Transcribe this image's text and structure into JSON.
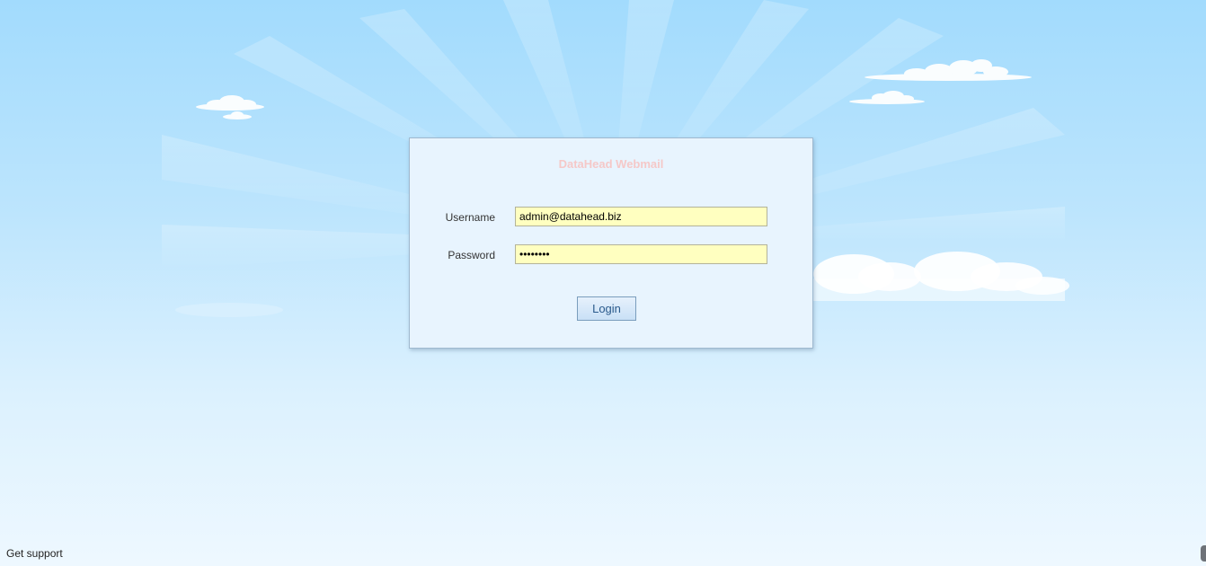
{
  "login": {
    "title": "DataHead Webmail",
    "username_label": "Username",
    "username_value": "admin@datahead.biz",
    "password_label": "Password",
    "password_value": "password",
    "login_button": "Login"
  },
  "footer": {
    "support_link": "Get support"
  },
  "colors": {
    "title": "#f5c8c8",
    "input_background": "#ffffc0",
    "button_text": "#2a5a8c",
    "panel_background": "#e8f4fe"
  }
}
